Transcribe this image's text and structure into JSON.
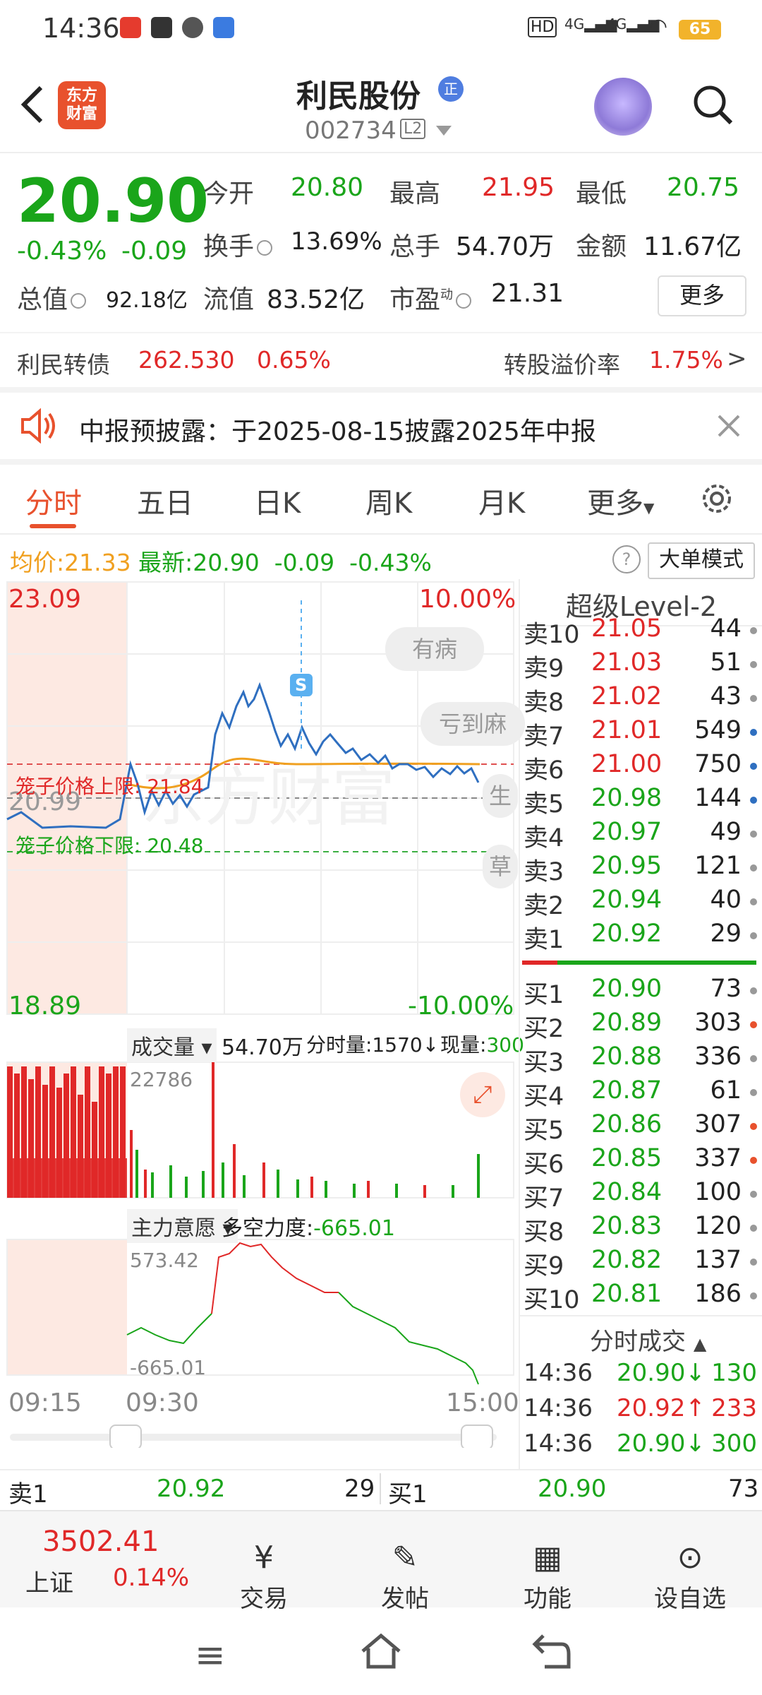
{
  "status_bar": {
    "time": "14:36",
    "battery": "65",
    "net1": "4G",
    "net2": "4G"
  },
  "header": {
    "logo_text_1": "东方",
    "logo_text_2": "财富",
    "title": "利民股份",
    "badge": "正",
    "code": "002734",
    "level": "L2"
  },
  "quote": {
    "price": "20.90",
    "change_pct": "-0.43%",
    "change": "-0.09",
    "open_label": "今开",
    "open": "20.80",
    "high_label": "最高",
    "high": "21.95",
    "low_label": "最低",
    "low": "20.75",
    "turnover_label": "换手",
    "turnover": "13.69%",
    "volume_label": "总手",
    "volume": "54.70万",
    "amount_label": "金额",
    "amount": "11.67亿",
    "mcap_label": "总值",
    "mcap": "92.18亿",
    "float_label": "流值",
    "float": "83.52亿",
    "pe_label": "市盈",
    "pe_sup": "动",
    "pe": "21.31",
    "more": "更多"
  },
  "bond": {
    "label": "利民转债",
    "price": "262.530",
    "pct": "0.65%",
    "premium_label": "转股溢价率",
    "premium": "1.75%"
  },
  "notice": {
    "text": "中报预披露：于2025-08-15披露2025年中报"
  },
  "tabs": [
    "分时",
    "五日",
    "日K",
    "周K",
    "月K",
    "更多"
  ],
  "chart_info": {
    "avg_label": "均价:",
    "avg": "21.33",
    "latest_label": "最新:",
    "latest": "20.90",
    "chg": "-0.09",
    "pct": "-0.43%",
    "mode_btn": "大单模式"
  },
  "chart_axis": {
    "top_price": "23.09",
    "top_pct": "10.00%",
    "bottom_price": "18.89",
    "bottom_pct": "-10.00%",
    "mid_price": "20.99",
    "upper_cage": "笼子价格上限: 21.84",
    "lower_cage": "笼子价格下限: 20.48",
    "marker": "S"
  },
  "overlay": {
    "pill1": "有病",
    "pill2": "亏到麻",
    "pill3": "生",
    "pill4": "草"
  },
  "volume_panel": {
    "label": "成交量",
    "value": "54.70万",
    "tick_label": "分时量:1570↓",
    "current_label": "现量:300",
    "max": "22786"
  },
  "force_panel": {
    "label": "主力意愿",
    "value_label": "多空力度:",
    "value": "-665.01",
    "max": "573.42",
    "min": "-665.01"
  },
  "time_axis": {
    "t1": "09:15",
    "t2": "09:30",
    "t3": "15:00"
  },
  "order_book": {
    "title": "超级Level-2",
    "sells": [
      {
        "label": "卖10",
        "price": "21.05",
        "vol": "44",
        "dot": "gray",
        "color": "red"
      },
      {
        "label": "卖9",
        "price": "21.03",
        "vol": "51",
        "dot": "gray",
        "color": "red"
      },
      {
        "label": "卖8",
        "price": "21.02",
        "vol": "43",
        "dot": "gray",
        "color": "red"
      },
      {
        "label": "卖7",
        "price": "21.01",
        "vol": "549",
        "dot": "blue",
        "color": "red"
      },
      {
        "label": "卖6",
        "price": "21.00",
        "vol": "750",
        "dot": "blue",
        "color": "red"
      },
      {
        "label": "卖5",
        "price": "20.98",
        "vol": "144",
        "dot": "blue",
        "color": "green"
      },
      {
        "label": "卖4",
        "price": "20.97",
        "vol": "49",
        "dot": "gray",
        "color": "green"
      },
      {
        "label": "卖3",
        "price": "20.95",
        "vol": "121",
        "dot": "gray",
        "color": "green"
      },
      {
        "label": "卖2",
        "price": "20.94",
        "vol": "40",
        "dot": "gray",
        "color": "green"
      },
      {
        "label": "卖1",
        "price": "20.92",
        "vol": "29",
        "dot": "gray",
        "color": "green"
      }
    ],
    "buys": [
      {
        "label": "买1",
        "price": "20.90",
        "vol": "73",
        "dot": "gray",
        "color": "green"
      },
      {
        "label": "买2",
        "price": "20.89",
        "vol": "303",
        "dot": "orange",
        "color": "green"
      },
      {
        "label": "买3",
        "price": "20.88",
        "vol": "336",
        "dot": "gray",
        "color": "green"
      },
      {
        "label": "买4",
        "price": "20.87",
        "vol": "61",
        "dot": "gray",
        "color": "green"
      },
      {
        "label": "买5",
        "price": "20.86",
        "vol": "307",
        "dot": "orange",
        "color": "green"
      },
      {
        "label": "买6",
        "price": "20.85",
        "vol": "337",
        "dot": "orange",
        "color": "green"
      },
      {
        "label": "买7",
        "price": "20.84",
        "vol": "100",
        "dot": "gray",
        "color": "green"
      },
      {
        "label": "买8",
        "price": "20.83",
        "vol": "120",
        "dot": "gray",
        "color": "green"
      },
      {
        "label": "买9",
        "price": "20.82",
        "vol": "137",
        "dot": "gray",
        "color": "green"
      },
      {
        "label": "买10",
        "price": "20.81",
        "vol": "186",
        "dot": "gray",
        "color": "green"
      }
    ],
    "trades_title": "分时成交",
    "trades": [
      {
        "time": "14:36",
        "price": "20.90",
        "dir": "↓",
        "vol": "130",
        "color": "green"
      },
      {
        "time": "14:36",
        "price": "20.92",
        "dir": "↑",
        "vol": "233",
        "color": "red"
      },
      {
        "time": "14:36",
        "price": "20.90",
        "dir": "↓",
        "vol": "300",
        "color": "green"
      }
    ]
  },
  "bottom_quote": {
    "sell_label": "卖1",
    "sell_price": "20.92",
    "sell_vol": "29",
    "buy_label": "买1",
    "buy_price": "20.90",
    "buy_vol": "73"
  },
  "index": {
    "value": "3502.41",
    "name": "上证",
    "pct": "0.14%"
  },
  "bottom_nav": [
    "交易",
    "发帖",
    "功能",
    "设自选"
  ],
  "colors": {
    "up": "#e02828",
    "down": "#1aa51a",
    "accent": "#e8512d",
    "avg_line": "#f0a020",
    "price_line": "#2f6fc0"
  }
}
